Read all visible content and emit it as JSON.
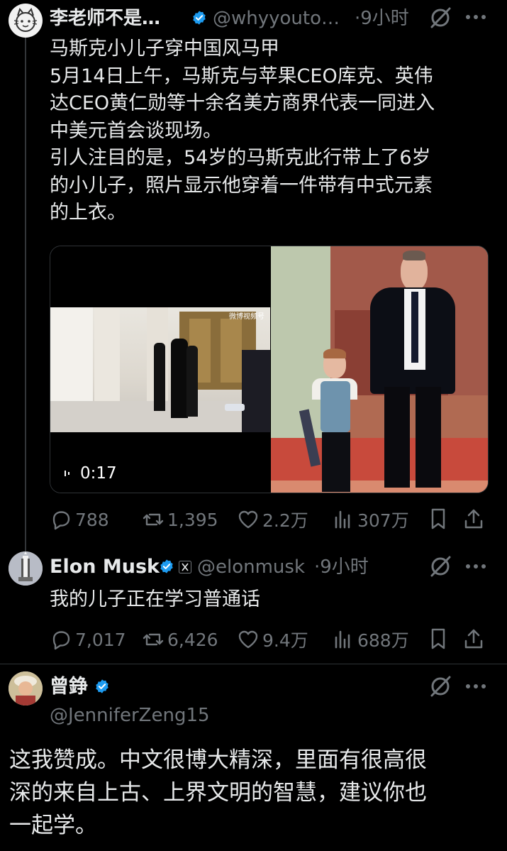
{
  "post1": {
    "name": "李老师不是…",
    "handle": "@whyyouto…",
    "time": "·9小时",
    "lines": [
      "马斯克小儿子穿中国风马甲",
      "5月14日上午，马斯克与苹果CEO库克、英伟",
      "达CEO黄仁勋等十余名美方商界代表一同进入",
      "中美元首会谈现场。",
      "引人注目的是，54岁的马斯克此行带上了6岁",
      "的小儿子，照片显示他穿着一件带有中式元素",
      "的上衣。"
    ],
    "video_duration": "0:17",
    "video_watermark": "微博视频号",
    "stats": {
      "replies": "788",
      "reposts": "1,395",
      "likes": "2.2万",
      "views": "307万"
    }
  },
  "post2": {
    "name": "Elon Musk",
    "handle": "@elonmusk",
    "time": "·9小时",
    "text": "我的儿子正在学习普通话",
    "stats": {
      "replies": "7,017",
      "reposts": "6,426",
      "likes": "9.4万",
      "views": "688万"
    }
  },
  "post3": {
    "name": "曾錚",
    "handle": "@JenniferZeng15",
    "lines": [
      "这我赞成。中文很博大精深，里面有很高很",
      "深的来自上古、上界文明的智慧，建议你也",
      "一起学。"
    ]
  },
  "colors": {
    "verified": "#1d9bf0",
    "muted": "#71767b",
    "text": "#e7e9ea"
  }
}
